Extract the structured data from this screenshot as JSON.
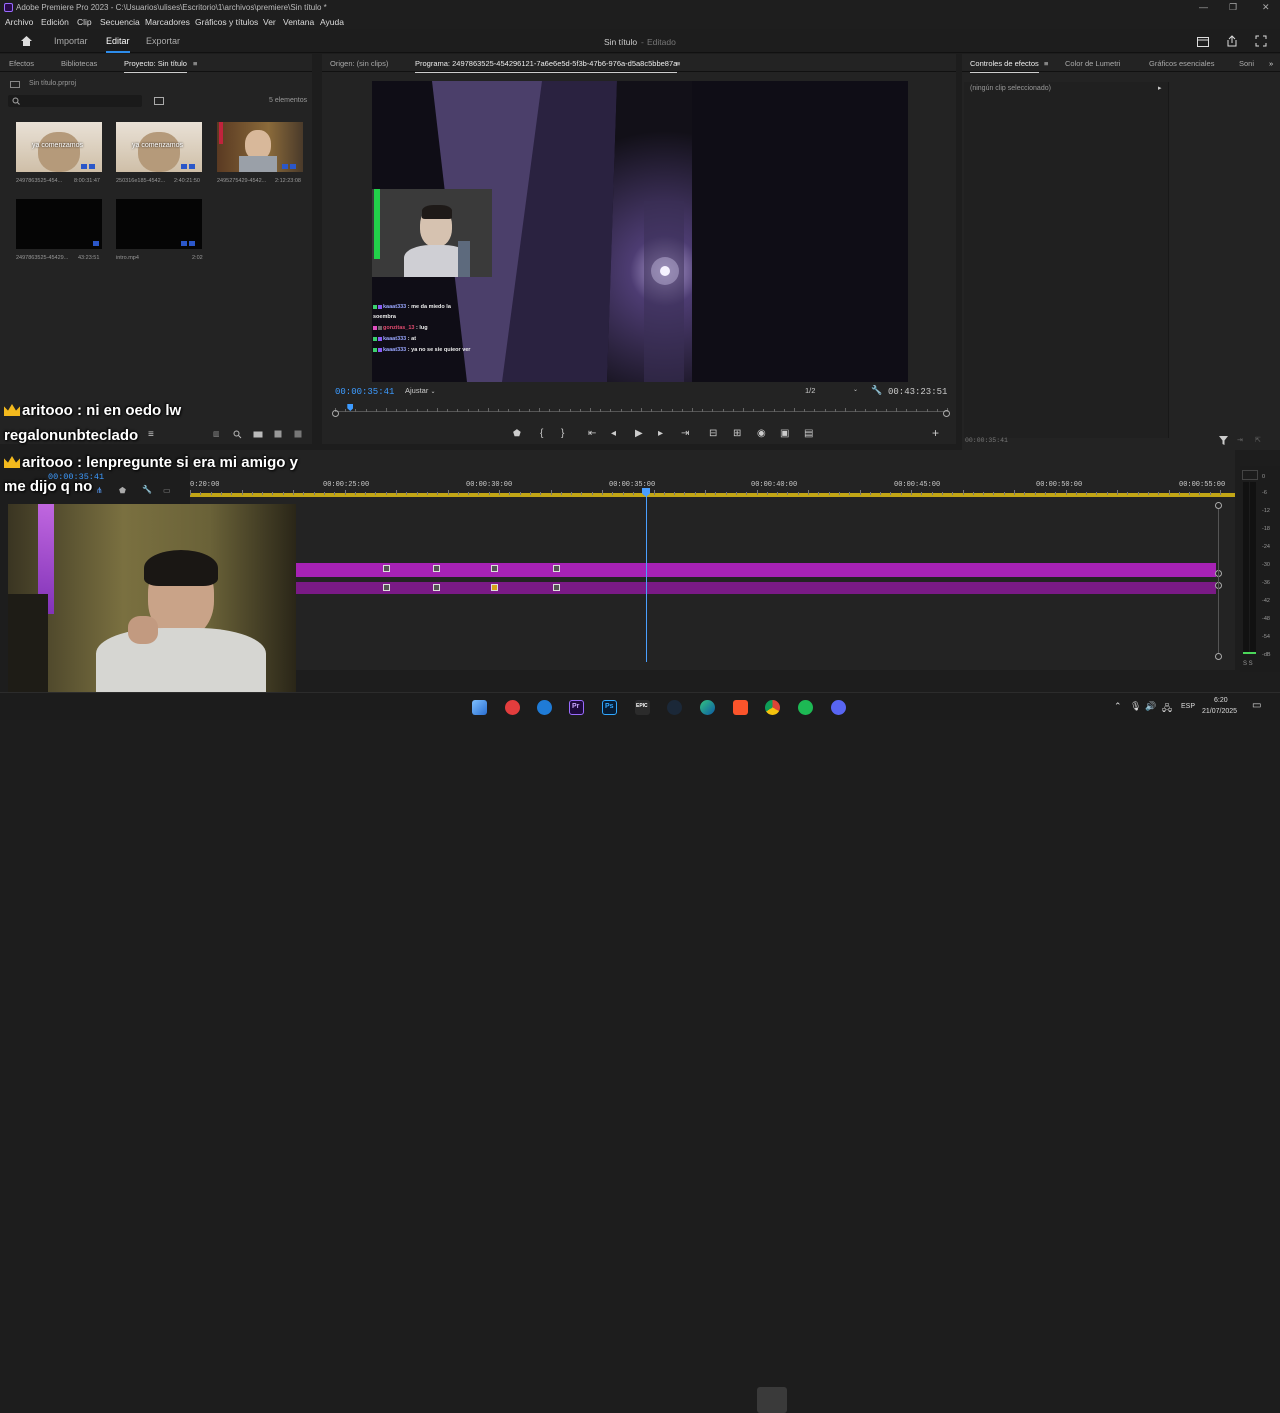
{
  "window": {
    "title": "Adobe Premiere Pro 2023 - C:\\Usuarios\\ulises\\Escritorio\\1\\archivos\\premiere\\Sin título *"
  },
  "menu": [
    "Archivo",
    "Edición",
    "Clip",
    "Secuencia",
    "Marcadores",
    "Gráficos y títulos",
    "Ver",
    "Ventana",
    "Ayuda"
  ],
  "workspace": {
    "tabs": [
      "Importar",
      "Editar",
      "Exportar"
    ],
    "active": "Editar",
    "project_title": "Sin título",
    "project_status": "Editado"
  },
  "project_panel": {
    "tabs": [
      "Efectos",
      "Bibliotecas",
      "Proyecto: Sin título"
    ],
    "file_name": "Sin título.prproj",
    "item_count": "5 elementos",
    "items": [
      {
        "name": "2497863525-454...",
        "duration": "8:00:31:47",
        "overlay": "ya comenzamos"
      },
      {
        "name": "250316e185-4542...",
        "duration": "2:40:21:50",
        "overlay": "ya comenzamos"
      },
      {
        "name": "2495275429-4542...",
        "duration": "2:12:23:08",
        "overlay": ""
      },
      {
        "name": "2497863525-45429...",
        "duration": "43:23:51",
        "overlay": ""
      },
      {
        "name": "intro.mp4",
        "duration": "2:02",
        "overlay": ""
      }
    ]
  },
  "source_monitor": {
    "tab": "Origen: (sin clips)"
  },
  "program_monitor": {
    "tab": "Programa: 2497863525-454296121-7a6e6e5d-5f3b-47b6-976a-d5a8c5bbe87a",
    "timecode": "00:00:35:41",
    "fit": "Ajustar",
    "resolution": "1/2",
    "duration": "00:43:23:51",
    "progress_fraction": 0.025,
    "chat": [
      {
        "user": "kaaat333",
        "text": ": me da miedo la"
      },
      {
        "user": "",
        "text": "soembra"
      },
      {
        "user": "gonzitas_13",
        "text": ": lug"
      },
      {
        "user": "kaaat333",
        "text": ": at"
      },
      {
        "user": "kaaat333",
        "text": ": ya no se sie quieor ver"
      }
    ]
  },
  "effects_panel": {
    "tabs": [
      "Controles de efectos",
      "Color de Lumetri",
      "Gráficos esenciales",
      "Soni"
    ],
    "no_clip": "(ningún clip seleccionado)",
    "timecode": "00:00:35:41"
  },
  "timeline": {
    "timecode": "00:00:35:41",
    "ruler": [
      "0:20:00",
      "00:00:25:00",
      "00:00:30:00",
      "00:00:35:00",
      "00:00:40:00",
      "00:00:45:00",
      "00:00:50:00",
      "00:00:55:00"
    ],
    "meter_labels": [
      "0",
      "-6",
      "-12",
      "-18",
      "-24",
      "-30",
      "-36",
      "-42",
      "-48",
      "-54",
      "-dB"
    ],
    "meter_footer": "S S"
  },
  "stream_overlay": {
    "lines": [
      {
        "user": "aritooo",
        "text": ": ni en oedo lw"
      },
      {
        "user": "",
        "text": "regalonunbteclado"
      },
      {
        "user": "aritooo",
        "text": ": lenpregunte si era mi amigo y"
      },
      {
        "user": "",
        "text": "me dijo q no"
      }
    ]
  },
  "taskbar": {
    "lang": "ESP",
    "time": "6:20",
    "date": "21/07/2025"
  },
  "colors": {
    "accent": "#2d8ceb",
    "clip": "#a722b5",
    "playhead": "#4a9fff"
  }
}
